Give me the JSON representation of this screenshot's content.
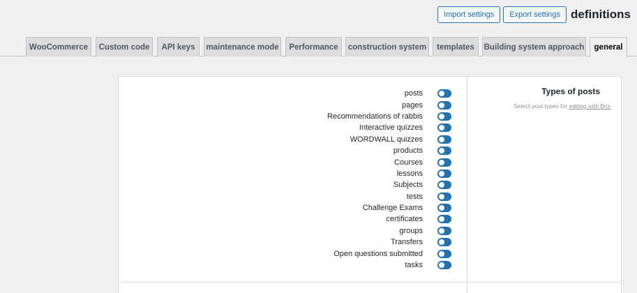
{
  "header": {
    "import_label": "Import settings",
    "export_label": "Export settings",
    "title": "definitions"
  },
  "tabs": [
    {
      "label": "WooCommerce"
    },
    {
      "label": "Custom code"
    },
    {
      "label": "API keys"
    },
    {
      "label": "maintenance mode"
    },
    {
      "label": "Performance"
    },
    {
      "label": "construction system"
    },
    {
      "label": "templates"
    },
    {
      "label": "Building system approach"
    },
    {
      "label": "general",
      "active": true
    }
  ],
  "post_types": {
    "title": "Types of posts",
    "description_prefix": ". Select post types for ",
    "description_link": "editing with Brix",
    "items": [
      {
        "label": "posts",
        "enabled": true
      },
      {
        "label": "pages",
        "enabled": true
      },
      {
        "label": "Recommendations of rabbis",
        "enabled": true
      },
      {
        "label": "Interactive quizzes",
        "enabled": true
      },
      {
        "label": "WORDWALL quizzes",
        "enabled": true
      },
      {
        "label": "products",
        "enabled": true
      },
      {
        "label": "Courses",
        "enabled": true
      },
      {
        "label": "lessons",
        "enabled": true
      },
      {
        "label": "Subjects",
        "enabled": true
      },
      {
        "label": "tests",
        "enabled": true
      },
      {
        "label": "Challenge Exams",
        "enabled": true
      },
      {
        "label": "certificates",
        "enabled": true
      },
      {
        "label": "groups",
        "enabled": true
      },
      {
        "label": "Transfers",
        "enabled": true
      },
      {
        "label": "Open questions submitted",
        "enabled": true
      },
      {
        "label": "tasks",
        "enabled": true
      }
    ]
  },
  "colors": {
    "accent": "#2271b1",
    "background": "#f0f0f1",
    "panel": "#ffffff"
  }
}
